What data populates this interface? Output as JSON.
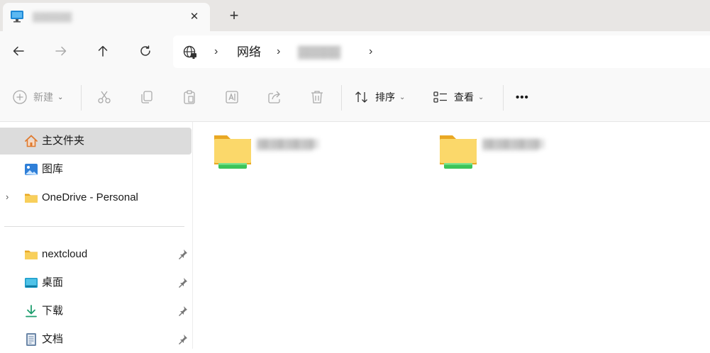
{
  "tab": {
    "title": "▒▒▒▒▒▒",
    "close": "✕",
    "new_tab": "+"
  },
  "address": {
    "crumbs": [
      "网络",
      "▒▒▒▒▒"
    ],
    "separator": "›"
  },
  "toolbar": {
    "new_label": "新建",
    "sort_label": "排序",
    "view_label": "查看",
    "more_label": "•••"
  },
  "sidebar": {
    "items": [
      {
        "label": "主文件夹",
        "icon": "home-icon",
        "selected": true
      },
      {
        "label": "图库",
        "icon": "gallery-icon"
      },
      {
        "label": "OneDrive - Personal",
        "icon": "folder-icon",
        "expander": "›"
      }
    ],
    "pinned": [
      {
        "label": "nextcloud",
        "icon": "folder-icon"
      },
      {
        "label": "桌面",
        "icon": "desktop-icon"
      },
      {
        "label": "下载",
        "icon": "download-icon"
      },
      {
        "label": "文档",
        "icon": "document-icon"
      }
    ]
  },
  "content": {
    "folders": [
      {
        "name": "▒▒▒▒▒▒▒",
        "icon": "network-folder-icon"
      },
      {
        "name": "▒▒▒▒▒▒▒",
        "icon": "network-folder-icon"
      }
    ]
  },
  "colors": {
    "folder_yellow": "#f5c542",
    "folder_green": "#3cc45a",
    "accent": "#0067c0"
  }
}
